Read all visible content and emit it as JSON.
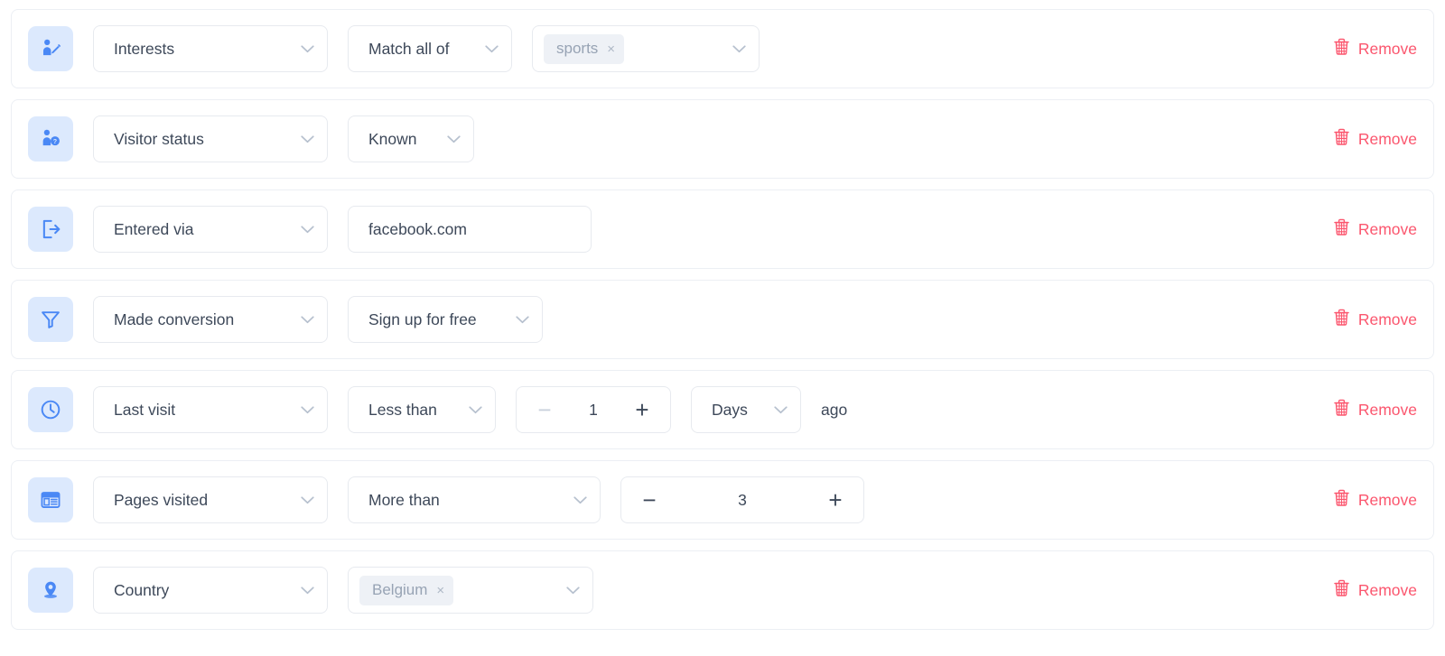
{
  "remove_label": "Remove",
  "colors": {
    "accent_blue": "#4a88f5",
    "icon_tile_bg": "#dce9fd",
    "remove_red": "#fb566e",
    "chip_bg": "#eef1f6",
    "border": "#e7eaef",
    "text": "#3d4859",
    "muted": "#97a3b4"
  },
  "rules": [
    {
      "icon": "person-edit-icon",
      "subject": "Interests",
      "operator": "Match all of",
      "tag": "sports",
      "tag_close": "×",
      "chevron": "⌄"
    },
    {
      "icon": "person-question-icon",
      "subject": "Visitor status",
      "operator": "Known"
    },
    {
      "icon": "exit-arrow-icon",
      "subject": "Entered via",
      "value": "facebook.com"
    },
    {
      "icon": "funnel-filter-icon",
      "subject": "Made conversion",
      "operator": "Sign up for free"
    },
    {
      "icon": "clock-icon",
      "subject": "Last visit",
      "operator": "Less than",
      "stepper": {
        "value": "1",
        "minus": "−",
        "plus": "+",
        "minus_disabled": true
      },
      "unit": "Days",
      "suffix": "ago"
    },
    {
      "icon": "browser-page-icon",
      "subject": "Pages visited",
      "operator": "More than",
      "stepper": {
        "value": "3",
        "minus": "−",
        "plus": "+",
        "minus_disabled": false
      }
    },
    {
      "icon": "location-pin-icon",
      "subject": "Country",
      "tag": "Belgium",
      "tag_close": "×"
    }
  ]
}
